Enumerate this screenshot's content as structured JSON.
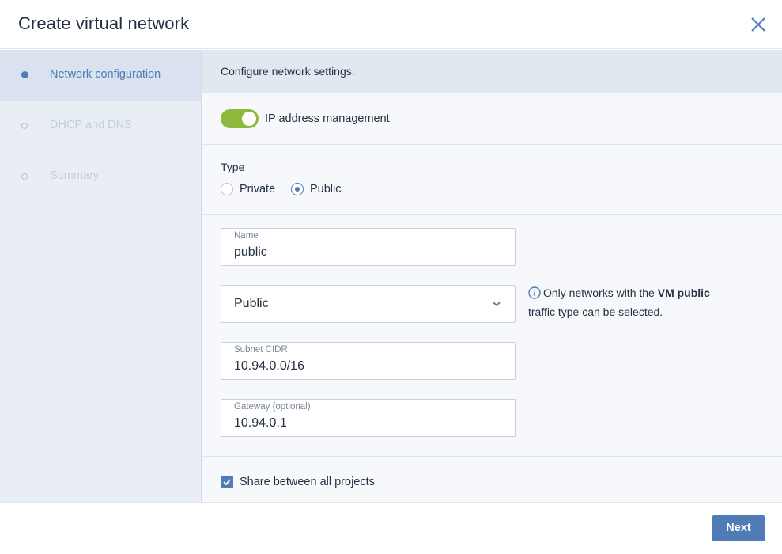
{
  "dialog": {
    "title": "Create virtual network",
    "close_icon": "close-icon"
  },
  "steps": [
    {
      "label": "Network configuration",
      "state": "active"
    },
    {
      "label": "DHCP and DNS",
      "state": "inactive"
    },
    {
      "label": "Summary",
      "state": "inactive"
    }
  ],
  "banner": {
    "text": "Configure network settings."
  },
  "ip_management": {
    "label": "IP address management",
    "enabled": true
  },
  "type": {
    "label": "Type",
    "options": [
      "Private",
      "Public"
    ],
    "selected": "Public"
  },
  "fields": {
    "name": {
      "label": "Name",
      "value": "public"
    },
    "network_select": {
      "value": "Public"
    },
    "subnet": {
      "label": "Subnet CIDR",
      "value": "10.94.0.0/16"
    },
    "gateway": {
      "label": "Gateway (optional)",
      "value": "10.94.0.1"
    }
  },
  "info": {
    "prefix": "Only networks with the ",
    "bold": "VM public",
    "line2": "traffic type can be selected."
  },
  "share": {
    "label": "Share between all projects",
    "checked": true
  },
  "footer": {
    "next_label": "Next"
  },
  "colors": {
    "accent": "#4f7cb5",
    "toggle_on": "#8dba3a",
    "sidebar_bg": "#e9eef5",
    "text": "#243143"
  }
}
